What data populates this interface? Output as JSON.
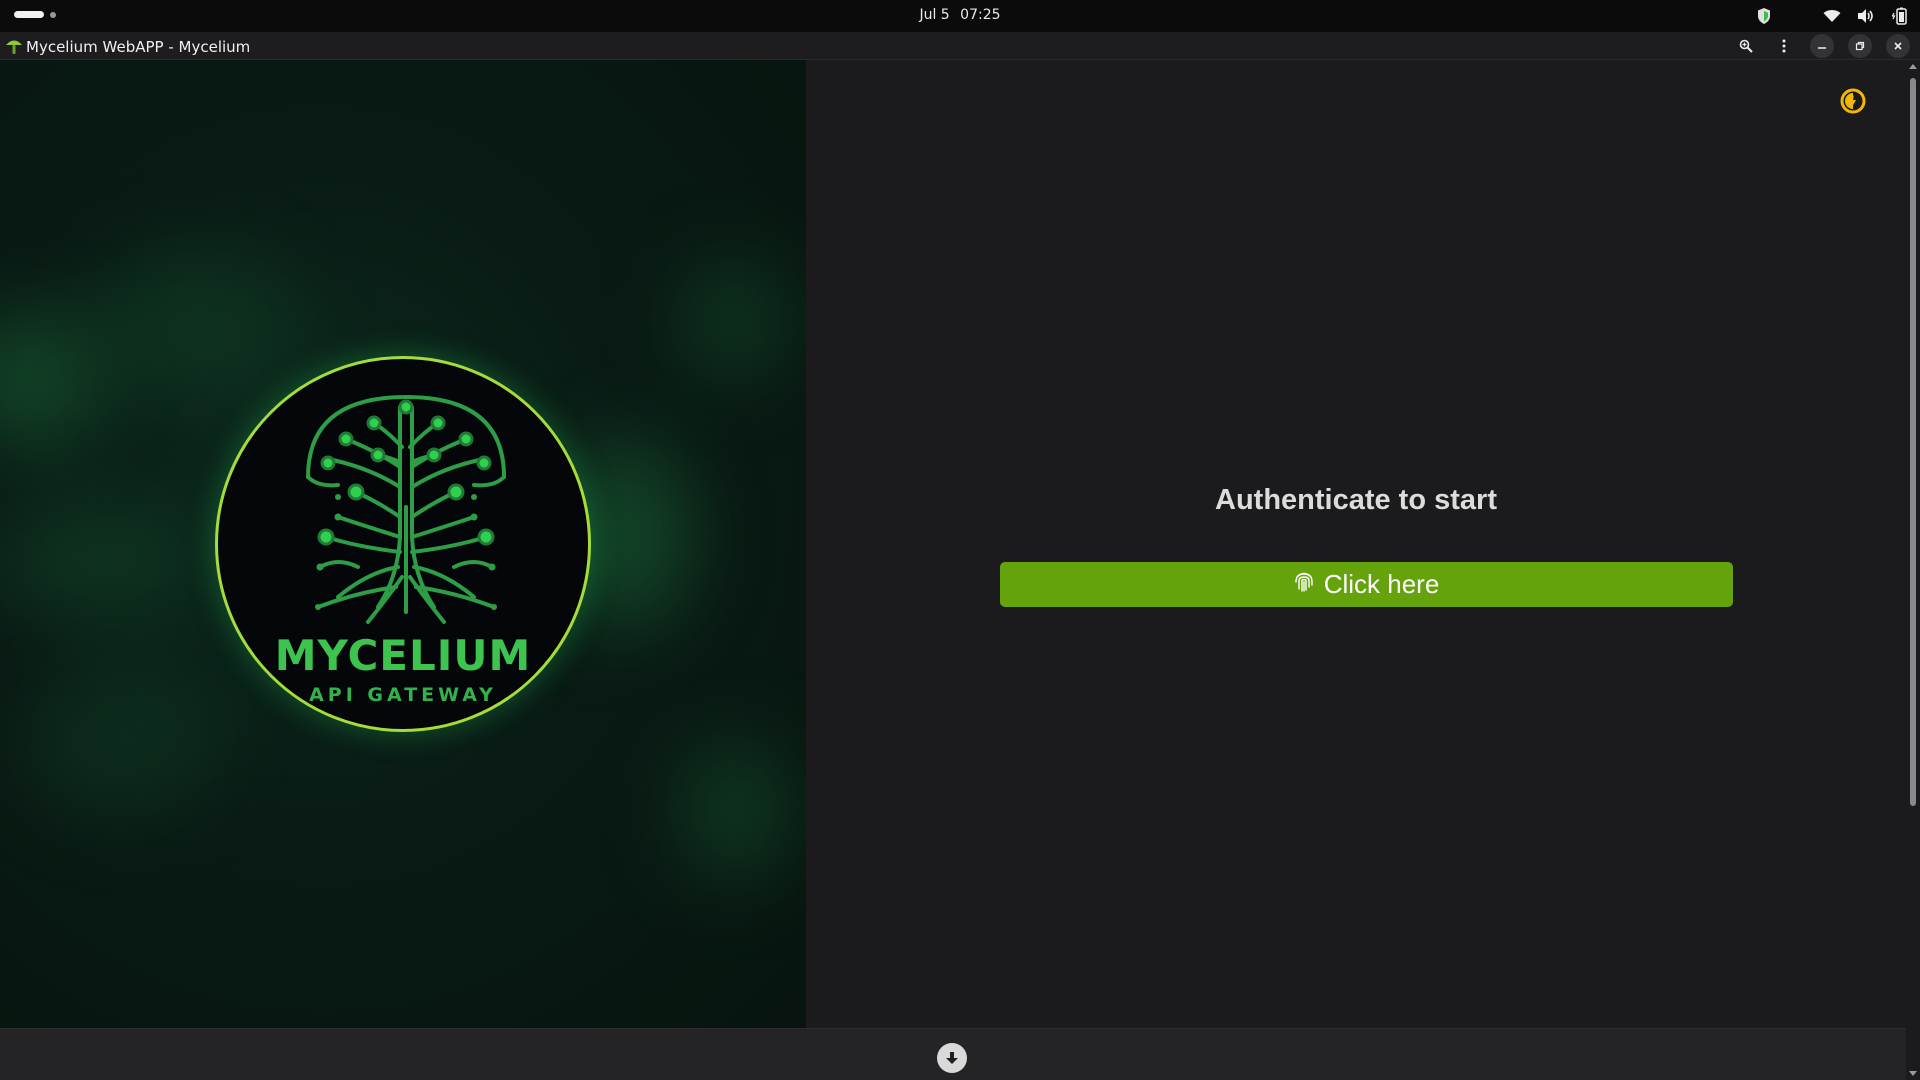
{
  "topbar": {
    "date": "Jul 5",
    "time": "07:25",
    "tray_icons": [
      "shield-icon",
      "wifi-icon",
      "volume-icon",
      "battery-icon"
    ]
  },
  "window": {
    "title": "Mycelium WebAPP - Mycelium",
    "controls": [
      "zoom-icon",
      "menu-kebab-icon",
      "minimize-icon",
      "restore-icon",
      "close-icon"
    ]
  },
  "logo": {
    "name": "MYCELIUM",
    "subtitle": "API GATEWAY"
  },
  "auth": {
    "title": "Authenticate to start",
    "button_label": "Click here",
    "button_icon": "fingerprint-icon"
  },
  "theme_toggle_icon": "theme-toggle-icon",
  "bottom": {
    "download_icon": "download-arrow-icon"
  },
  "colors": {
    "accent_button": "#65a30d",
    "theme_toggle": "#f2b705",
    "logo_ring": "#a6dc3a",
    "logo_green": "#3cc44f",
    "left_bg": "#091a14",
    "right_bg": "#1b1b1d"
  }
}
